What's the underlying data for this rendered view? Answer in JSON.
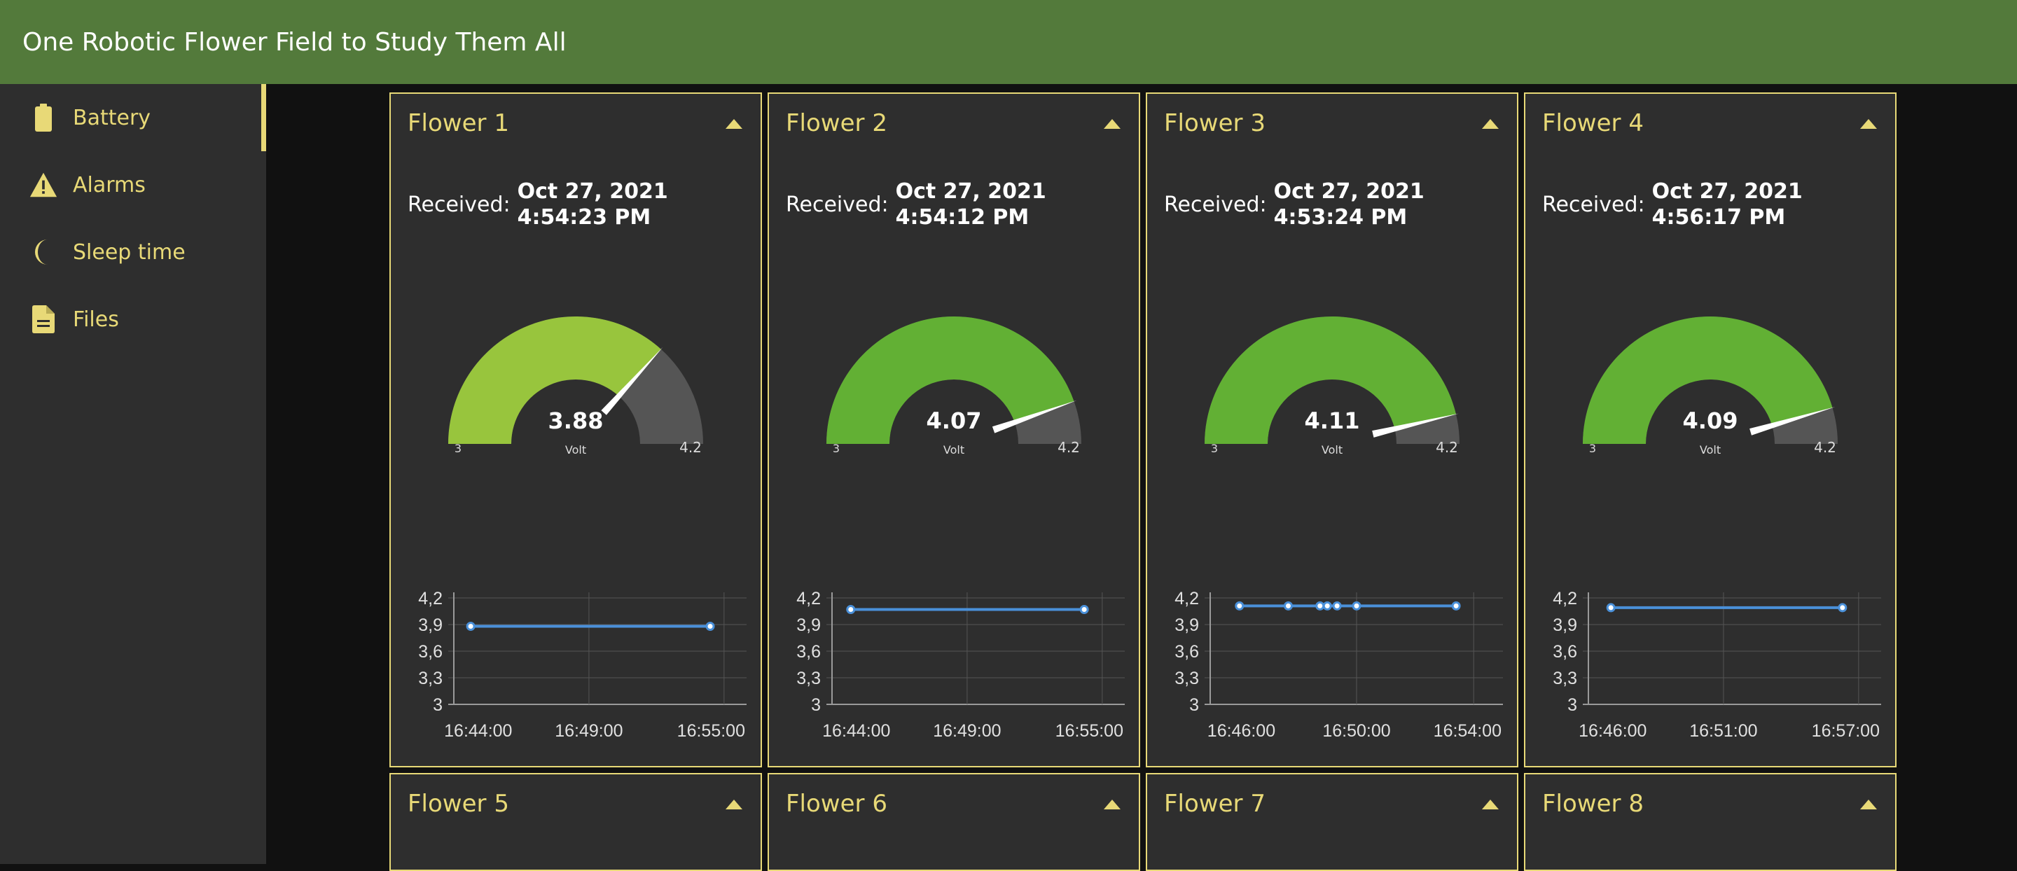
{
  "header": {
    "title": "One Robotic Flower Field to Study Them All"
  },
  "sidebar": {
    "items": [
      {
        "label": "Battery",
        "icon": "battery-icon",
        "active": true
      },
      {
        "label": "Alarms",
        "icon": "warning-icon",
        "active": false
      },
      {
        "label": "Sleep time",
        "icon": "moon-icon",
        "active": false
      },
      {
        "label": "Files",
        "icon": "file-icon",
        "active": false
      }
    ]
  },
  "theme": {
    "accent": "#e8d977",
    "header_bg": "#537a3b",
    "card_bg": "#2e2e2e",
    "gauge_track": "#555555",
    "line_color": "#4a90d9"
  },
  "received_label": "Received:",
  "flowers": [
    {
      "title": "Flower 1",
      "received": "Oct 27, 2021 4:54:23 PM",
      "gauge": {
        "value": 3.88,
        "value_label": "3.88",
        "unit": "Volt",
        "min_label": "3",
        "max_label": "4.2",
        "min": 3,
        "max": 4.2,
        "color": "#98c53d"
      },
      "chart_data": {
        "type": "line",
        "x": [
          "16:43:45",
          "16:54:23"
        ],
        "y": [
          3.88,
          3.88
        ],
        "xticks": [
          "16:44:00",
          "16:49:00",
          "16:55:00"
        ],
        "yticks": [
          "4,2",
          "3,9",
          "3,6",
          "3,3",
          "3"
        ],
        "ylim": [
          3,
          4.2
        ]
      }
    },
    {
      "title": "Flower 2",
      "received": "Oct 27, 2021 4:54:12 PM",
      "gauge": {
        "value": 4.07,
        "value_label": "4.07",
        "unit": "Volt",
        "min_label": "3",
        "max_label": "4.2",
        "min": 3,
        "max": 4.2,
        "color": "#62b034"
      },
      "chart_data": {
        "type": "line",
        "x": [
          "16:43:50",
          "16:54:12"
        ],
        "y": [
          4.07,
          4.07
        ],
        "xticks": [
          "16:44:00",
          "16:49:00",
          "16:55:00"
        ],
        "yticks": [
          "4,2",
          "3,9",
          "3,6",
          "3,3",
          "3"
        ],
        "ylim": [
          3,
          4.2
        ]
      }
    },
    {
      "title": "Flower 3",
      "received": "Oct 27, 2021 4:53:24 PM",
      "gauge": {
        "value": 4.11,
        "value_label": "4.11",
        "unit": "Volt",
        "min_label": "3",
        "max_label": "4.2",
        "min": 3,
        "max": 4.2,
        "color": "#62b034"
      },
      "chart_data": {
        "type": "line",
        "x": [
          "16:46:00",
          "16:47:40",
          "16:48:45",
          "16:49:00",
          "16:49:20",
          "16:50:00",
          "16:53:24"
        ],
        "y": [
          4.11,
          4.11,
          4.11,
          4.11,
          4.11,
          4.11,
          4.11
        ],
        "xticks": [
          "16:46:00",
          "16:50:00",
          "16:54:00"
        ],
        "yticks": [
          "4,2",
          "3,9",
          "3,6",
          "3,3",
          "3"
        ],
        "ylim": [
          3,
          4.2
        ]
      }
    },
    {
      "title": "Flower 4",
      "received": "Oct 27, 2021 4:56:17 PM",
      "gauge": {
        "value": 4.09,
        "value_label": "4.09",
        "unit": "Volt",
        "min_label": "3",
        "max_label": "4.2",
        "min": 3,
        "max": 4.2,
        "color": "#62b034"
      },
      "chart_data": {
        "type": "line",
        "x": [
          "16:46:00",
          "16:56:17"
        ],
        "y": [
          4.09,
          4.09
        ],
        "xticks": [
          "16:46:00",
          "16:51:00",
          "16:57:00"
        ],
        "yticks": [
          "4,2",
          "3,9",
          "3,6",
          "3,3",
          "3"
        ],
        "ylim": [
          3,
          4.2
        ]
      }
    },
    {
      "title": "Flower 5"
    },
    {
      "title": "Flower 6"
    },
    {
      "title": "Flower 7"
    },
    {
      "title": "Flower 8"
    }
  ]
}
